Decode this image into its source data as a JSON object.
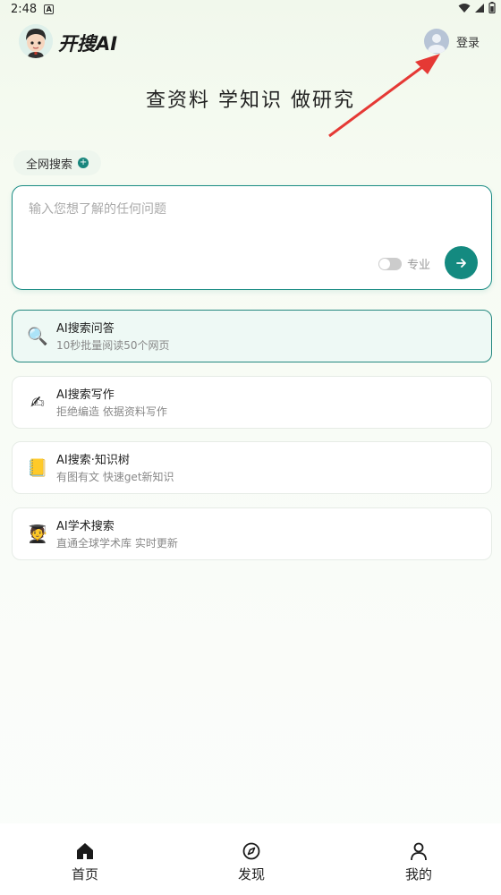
{
  "status_bar": {
    "time": "2:48",
    "notification_glyph": "A"
  },
  "header": {
    "app_name": "开搜AI",
    "login_label": "登录"
  },
  "slogan": "查资料 学知识 做研究",
  "scope_chip": {
    "label": "全网搜索",
    "plus": "+"
  },
  "search": {
    "placeholder": "输入您想了解的任何问题",
    "pro_label": "专业",
    "pro_enabled": false
  },
  "features": [
    {
      "icon": "magnifier-icon",
      "glyph": "🔍",
      "title": "AI搜索问答",
      "subtitle": "10秒批量阅读50个网页"
    },
    {
      "icon": "writing-hand-icon",
      "glyph": "✍",
      "title": "AI搜索写作",
      "subtitle": "拒绝编造 依据资料写作"
    },
    {
      "icon": "notebook-icon",
      "glyph": "📒",
      "title": "AI搜索·知识树",
      "subtitle": "有图有文 快速get新知识"
    },
    {
      "icon": "graduate-icon",
      "glyph": "🧑‍🎓",
      "title": "AI学术搜索",
      "subtitle": "直通全球学术库 实时更新"
    }
  ],
  "nav": {
    "items": [
      {
        "icon": "home-icon",
        "label": "首页"
      },
      {
        "icon": "compass-icon",
        "label": "发现"
      },
      {
        "icon": "user-icon",
        "label": "我的"
      }
    ]
  },
  "colors": {
    "accent": "#148a80",
    "annotation_arrow": "#e53935"
  }
}
